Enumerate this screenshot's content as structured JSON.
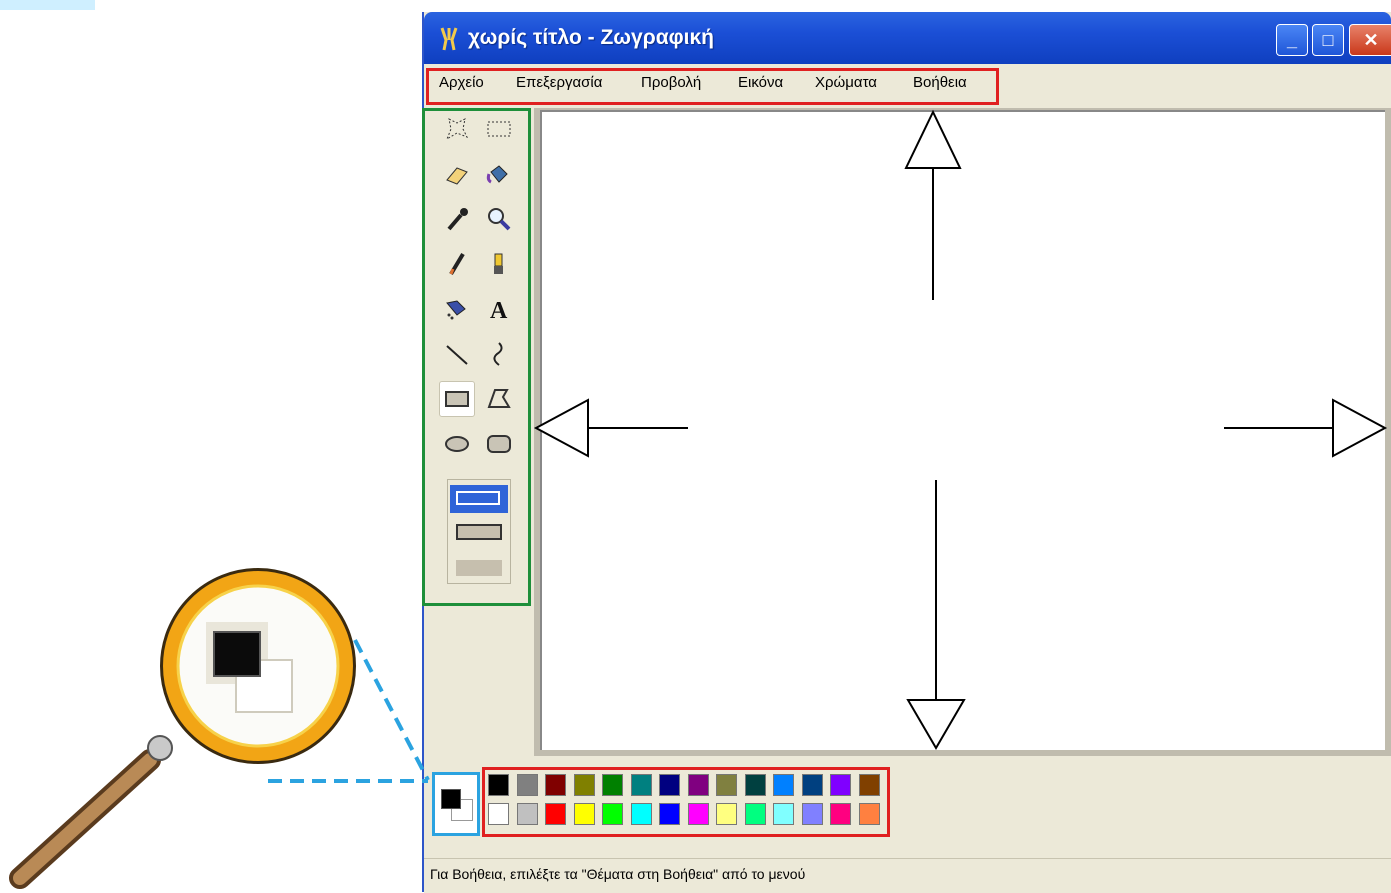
{
  "window": {
    "title": "χωρίς τίτλο - Ζωγραφική"
  },
  "menu": {
    "items": [
      "Αρχείο",
      "Επεξεργασία",
      "Προβολή",
      "Εικόνα",
      "Χρώματα",
      "Βοήθεια"
    ]
  },
  "toolbox": {
    "tools": [
      "free-select-icon",
      "rect-select-icon",
      "eraser-icon",
      "fill-icon",
      "color-picker-icon",
      "magnifier-icon",
      "pencil-icon",
      "brush-icon",
      "airbrush-icon",
      "text-icon",
      "line-icon",
      "curve-icon",
      "rectangle-icon",
      "polygon-icon",
      "ellipse-icon",
      "rounded-rect-icon"
    ],
    "selected_tool": "rectangle-icon"
  },
  "palette": {
    "primary": "#000000",
    "secondary": "#ffffff",
    "top_row": [
      "#000000",
      "#808080",
      "#800000",
      "#808000",
      "#008000",
      "#008080",
      "#000080",
      "#800080",
      "#808040",
      "#004040",
      "#0080ff",
      "#004080",
      "#8000ff",
      "#804000"
    ],
    "bottom_row": [
      "#ffffff",
      "#c0c0c0",
      "#ff0000",
      "#ffff00",
      "#00ff00",
      "#00ffff",
      "#0000ff",
      "#ff00ff",
      "#ffff80",
      "#00ff80",
      "#80ffff",
      "#8080ff",
      "#ff0080",
      "#ff8040"
    ]
  },
  "status": {
    "text": "Για Βοήθεια, επιλέξτε τα \"Θέματα στη Βοήθεια\" από το μενού"
  },
  "accents": {
    "menu_highlight": "#e02020",
    "toolbox_highlight": "#1e8f3a",
    "color_box_highlight": "#2ba3e0",
    "palette_highlight": "#e02020"
  }
}
